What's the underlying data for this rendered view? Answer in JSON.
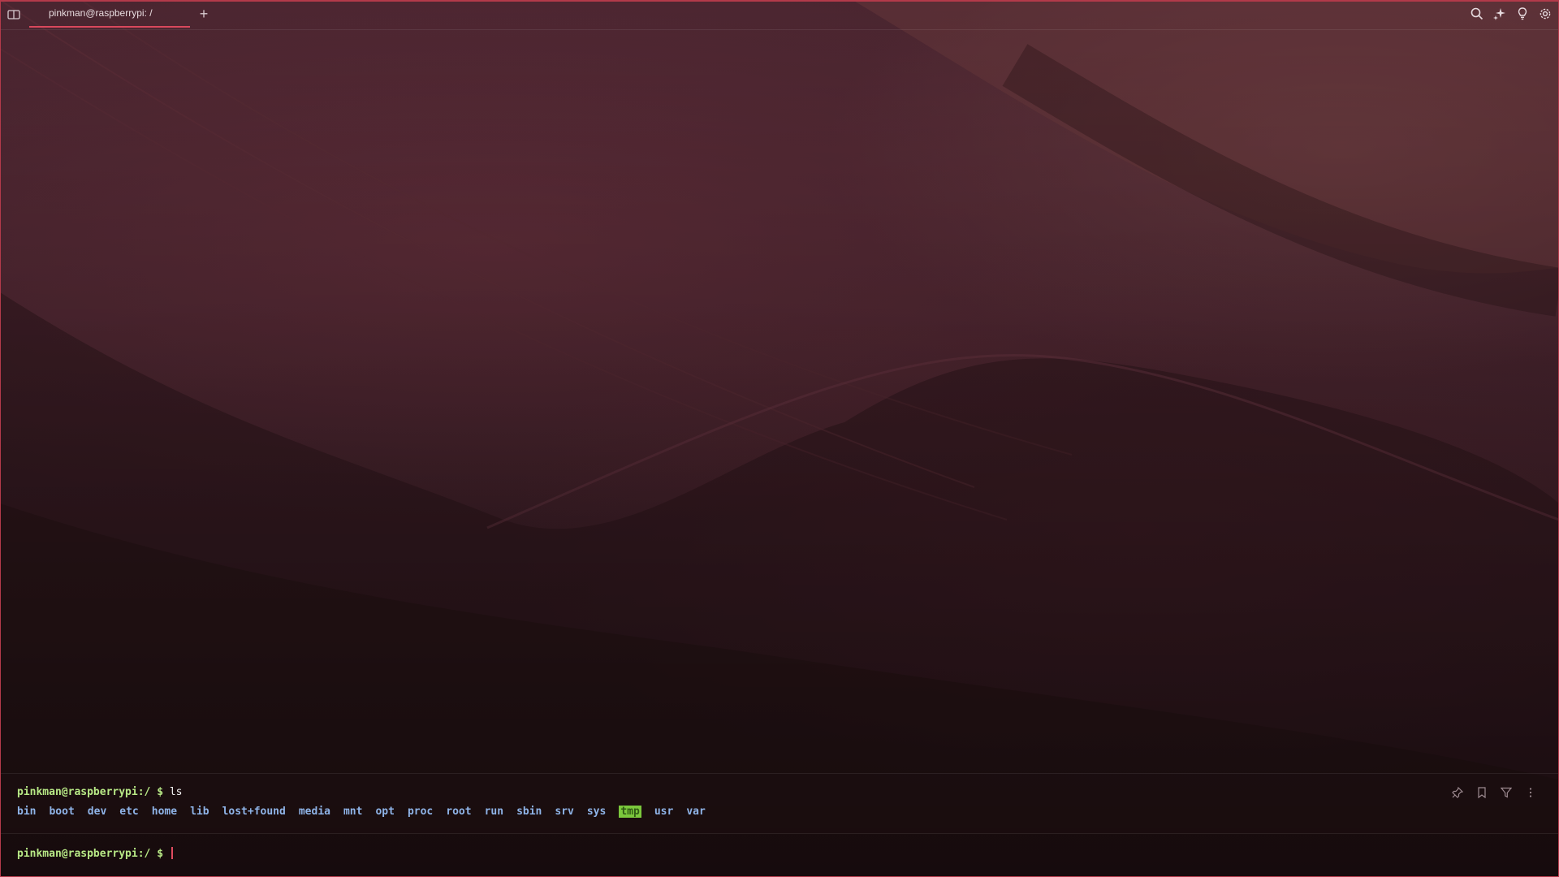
{
  "window": {
    "accent_color": "#d9485c",
    "frame_color": "#b33a4a"
  },
  "tabs": [
    {
      "label": "pinkman@raspberrypi: /",
      "active": true
    }
  ],
  "new_tab_label": "+",
  "toolbar_icons": [
    "search-icon",
    "ai-sparkle-icon",
    "lightbulb-icon",
    "gear-icon"
  ],
  "block": {
    "prompt": "pinkman@raspberrypi:/",
    "symbol": "$",
    "command": "ls",
    "output": [
      "bin",
      "boot",
      "dev",
      "etc",
      "home",
      "lib",
      "lost+found",
      "media",
      "mnt",
      "opt",
      "proc",
      "root",
      "run",
      "sbin",
      "srv",
      "sys",
      "tmp",
      "usr",
      "var"
    ],
    "highlighted_entry": "tmp",
    "action_icons": [
      "pin-icon",
      "bookmark-icon",
      "filter-icon",
      "more-icon"
    ]
  },
  "input": {
    "prompt": "pinkman@raspberrypi:/",
    "symbol": "$",
    "value": ""
  }
}
